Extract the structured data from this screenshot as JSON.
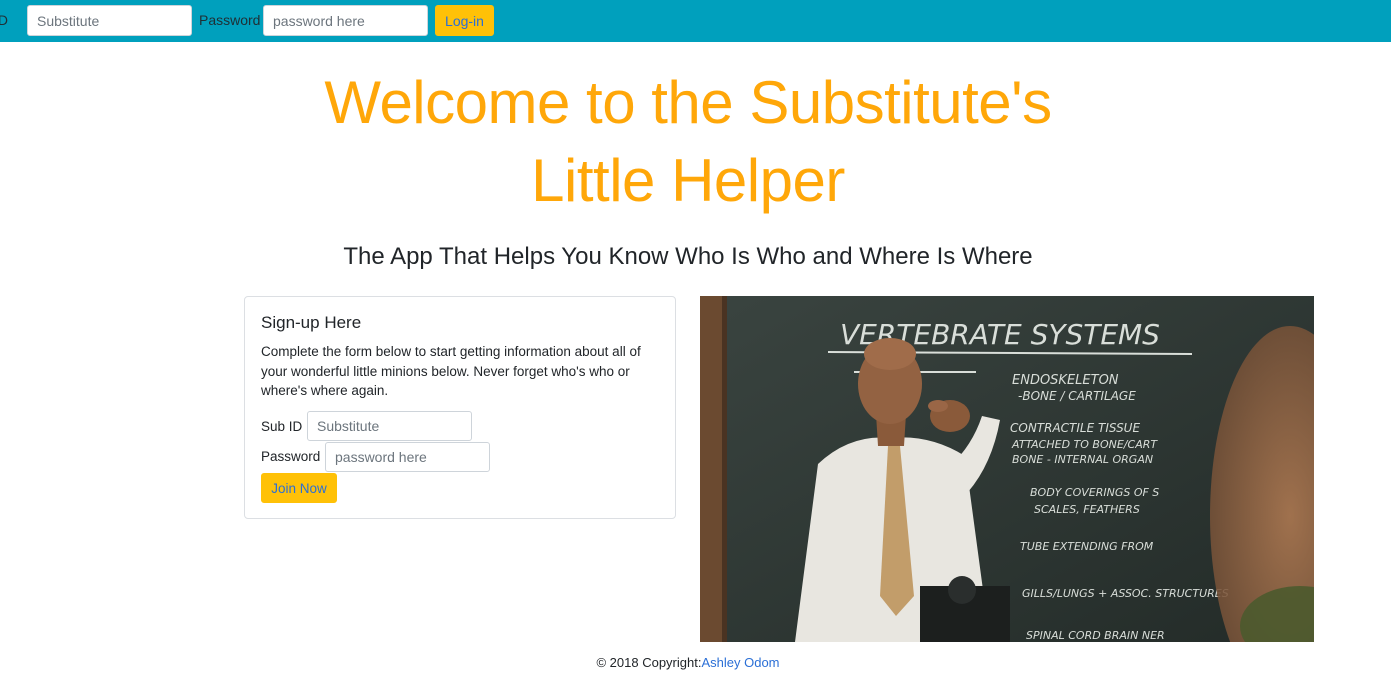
{
  "navbar": {
    "sub_id_label": "ID",
    "sub_id_placeholder": "Substitute",
    "password_label": "Password",
    "password_placeholder": "password here",
    "login_label": "Log-in",
    "background_color": "#00a0bd",
    "button_color": "#ffc107"
  },
  "hero": {
    "title_line1": "Welcome to the Substitute's",
    "title_line2": "Little Helper",
    "subtitle": "The App That Helps You Know Who Is Who and Where Is Where",
    "title_color": "#ffa709"
  },
  "signup": {
    "title": "Sign-up Here",
    "description": "Complete the form below to start getting information about all of your wonderful little minions below. Never forget who's who or where's where again.",
    "sub_id_label": "Sub ID",
    "sub_id_placeholder": "Substitute",
    "password_label": "Password",
    "password_placeholder": "password here",
    "join_label": "Join Now"
  },
  "image": {
    "chalkboard_heading": "VERTEBRATE SYSTEMS",
    "chalkboard_lines": [
      "ENDOSKELETON",
      "-BONE / CARTILAGE",
      "CONTRACTILE TISSUE",
      "ATTACHED TO BONE/CART",
      "BONE - INTERNAL ORGAN",
      "BODY COVERINGS OF S",
      "SCALES, FEATHERS",
      "TUBE EXTENDING FROM",
      "GILLS/LUNGS + ASSOC. STRUCTURES",
      "SPINAL CORD BRAIN NER"
    ]
  },
  "footer": {
    "copyright_text": "© 2018 Copyright:",
    "author_link": "Ashley Odom",
    "link_color": "#2b6fd6"
  }
}
